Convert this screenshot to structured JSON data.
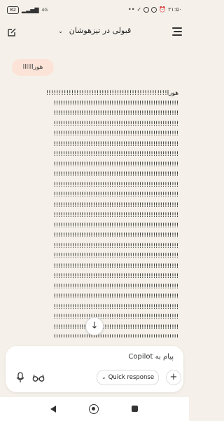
{
  "status": {
    "battery": "82",
    "time": "۲۱:۵۰",
    "network": "4G"
  },
  "header": {
    "title": "قبولی در تیزهوشان"
  },
  "chat": {
    "user_message": "هوراااااا",
    "response_first_line": "هورا!!!!!!!!!!!!!!!!!!!!!!!!!!!!!!!!!!!!!!!!!!!!!!!!",
    "response_line": "!!!!!!!!!!!!!!!!!!!!!!!!!!!!!!!!!!!!!!!!!!!!!!!!!!!!!!"
  },
  "composer": {
    "placeholder": "پیام به Copilot",
    "quick_response_label": "Quick response"
  }
}
